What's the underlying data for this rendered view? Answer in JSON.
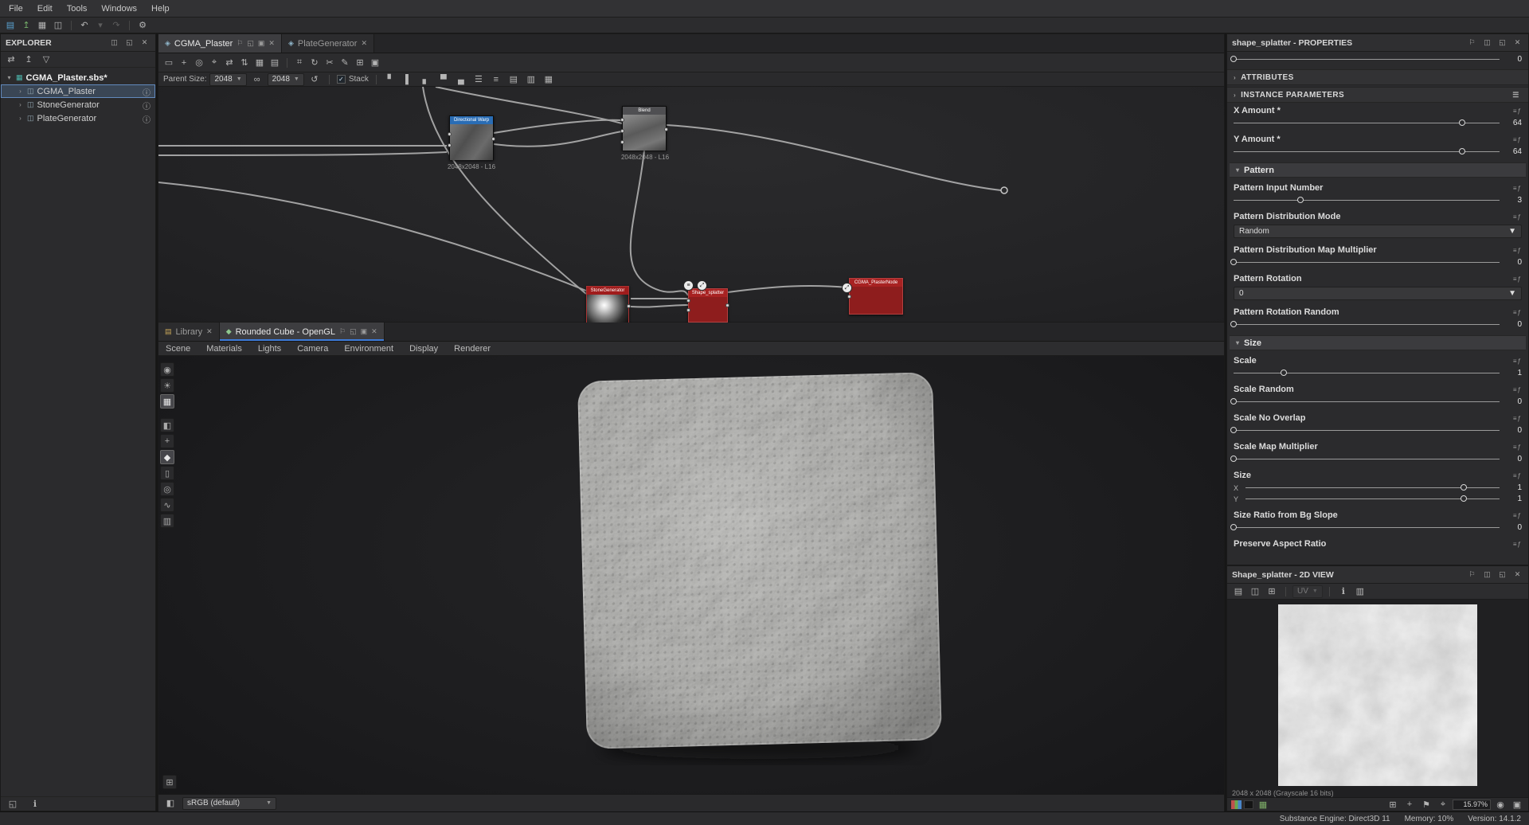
{
  "menubar": {
    "items": [
      "File",
      "Edit",
      "Tools",
      "Windows",
      "Help"
    ]
  },
  "explorer": {
    "title": "EXPLORER",
    "root_label": "CGMA_Plaster.sbs*",
    "items": [
      {
        "label": "CGMA_Plaster"
      },
      {
        "label": "StoneGenerator"
      },
      {
        "label": "PlateGenerator"
      }
    ]
  },
  "graph": {
    "tabs": [
      {
        "label": "CGMA_Plaster"
      },
      {
        "label": "PlateGenerator"
      }
    ],
    "parent_size_label": "Parent Size:",
    "width_value": "2048",
    "height_value": "2048",
    "stack_label": "Stack",
    "nodes": {
      "directional_warp": {
        "title": "Directional Warp",
        "subtitle": "2048x2048 - L16"
      },
      "blend": {
        "title": "Blend",
        "subtitle": "2048x2048 - L16"
      },
      "stone_generator": {
        "title": "StoneGenerator"
      },
      "shape_splatter": {
        "title": "Shape_splatter"
      },
      "cgma_plaster_node": {
        "title": "CGMA_PlasterNode"
      }
    }
  },
  "viewport": {
    "tabs": [
      {
        "label": "Library"
      },
      {
        "label": "Rounded Cube - OpenGL"
      }
    ],
    "menu": [
      "Scene",
      "Materials",
      "Lights",
      "Camera",
      "Environment",
      "Display",
      "Renderer"
    ],
    "colorspace": "sRGB (default)"
  },
  "properties": {
    "title": "shape_splatter - PROPERTIES",
    "top_slider": {
      "value": "0",
      "pct": "0%"
    },
    "attributes_label": "ATTRIBUTES",
    "instance_parameters_label": "INSTANCE PARAMETERS",
    "params": [
      {
        "label": "X Amount *",
        "value": "64",
        "pct": "86%"
      },
      {
        "label": "Y Amount *",
        "value": "64",
        "pct": "86%"
      },
      {
        "label": "Pattern"
      },
      {
        "label": "Pattern Input Number",
        "value": "3",
        "pct": "25%"
      },
      {
        "label": "Pattern Distribution Mode",
        "value": "Random"
      },
      {
        "label": "Pattern Distribution Map Multiplier",
        "value": "0",
        "pct": "0%"
      },
      {
        "label": "Pattern Rotation",
        "value": "0"
      },
      {
        "label": "Pattern Rotation Random",
        "value": "0",
        "pct": "0%"
      },
      {
        "label": "Size"
      },
      {
        "label": "Scale",
        "value": "1",
        "pct": "19%"
      },
      {
        "label": "Scale Random",
        "value": "0",
        "pct": "0%"
      },
      {
        "label": "Scale No Overlap",
        "value": "0",
        "pct": "0%"
      },
      {
        "label": "Scale Map Multiplier",
        "value": "0",
        "pct": "0%"
      },
      {
        "label": "Size",
        "x_label": "X",
        "x_value": "1",
        "x_pct": "86%",
        "y_label": "Y",
        "y_value": "1",
        "y_pct": "86%"
      },
      {
        "label": "Size Ratio from Bg Slope",
        "value": "0",
        "pct": "0%"
      },
      {
        "label": "Preserve Aspect Ratio"
      }
    ]
  },
  "view2d": {
    "title": "Shape_splatter - 2D VIEW",
    "uv_label": "UV",
    "info": "2048 x 2048 (Grayscale 16 bits)",
    "zoom": "15.97%"
  },
  "statusbar": {
    "engine": "Substance Engine: Direct3D 11",
    "memory": "Memory: 10%",
    "version": "Version: 14.1.2"
  }
}
